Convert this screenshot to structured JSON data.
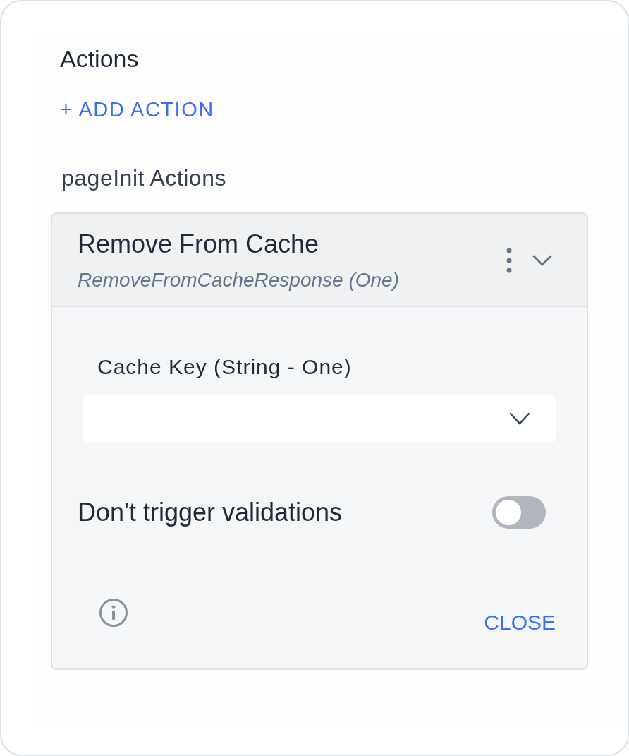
{
  "section_title": "Actions",
  "add_button": "+ ADD ACTION",
  "group_title": "pageInit Actions",
  "action": {
    "title": "Remove From Cache",
    "subtitle": "RemoveFromCacheResponse (One)",
    "expanded": true,
    "field": {
      "label": "Cache Key (String - One)"
    },
    "toggle": {
      "label": "Don't trigger validations",
      "on": false
    },
    "close_button": "CLOSE"
  }
}
